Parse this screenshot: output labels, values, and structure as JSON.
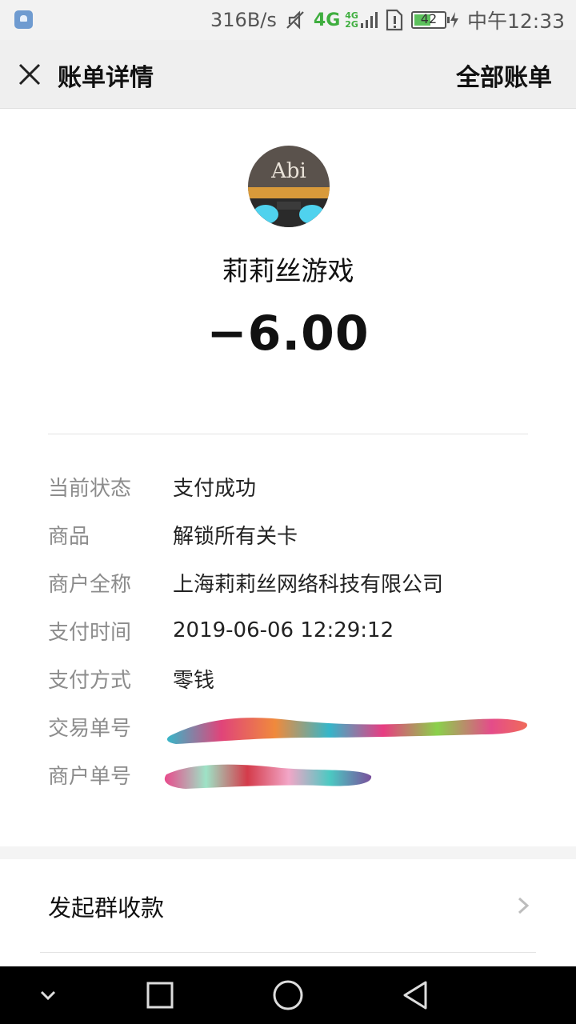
{
  "status_bar": {
    "net_speed": "316B/s",
    "network": "4G",
    "network_small_top": "4G",
    "network_small_bottom": "2G",
    "battery": "42",
    "time": "中午12:33"
  },
  "titlebar": {
    "title": "账单详情",
    "all_bills": "全部账单"
  },
  "header": {
    "avatar_text": "Abi",
    "merchant": "莉莉丝游戏",
    "amount": "−6.00"
  },
  "details": [
    {
      "label": "当前状态",
      "value": "支付成功"
    },
    {
      "label": "商品",
      "value": "解锁所有关卡"
    },
    {
      "label": "商户全称",
      "value": "上海莉莉丝网络科技有限公司"
    },
    {
      "label": "支付时间",
      "value": "2019-06-06 12:29:12"
    },
    {
      "label": "支付方式",
      "value": "零钱"
    },
    {
      "label": "交易单号",
      "value": ""
    },
    {
      "label": "商户单号",
      "value": ""
    }
  ],
  "group_collect": {
    "label": "发起群收款"
  },
  "colors": {
    "titlebar_bg": "#efefef",
    "label_gray": "#8c8c8c",
    "network_green": "#3fae3f"
  }
}
